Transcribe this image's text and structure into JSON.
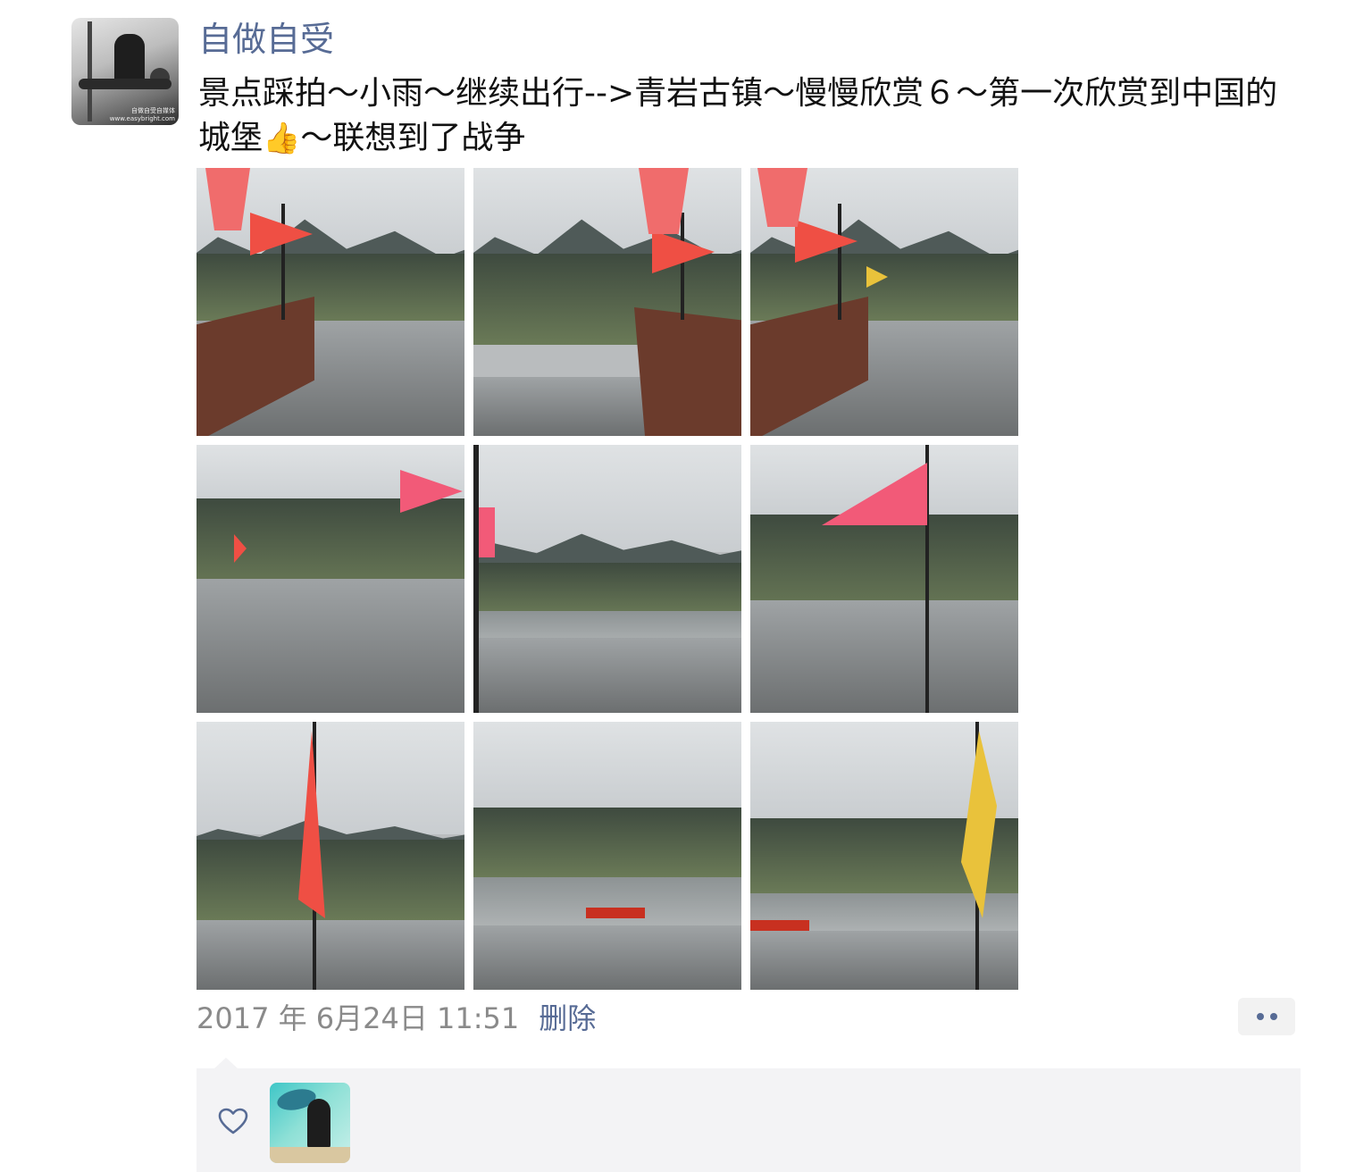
{
  "post": {
    "username": "自做自受",
    "text_main": "景点踩拍～小雨～继续出行-->青岩古镇～慢慢欣赏６～第一次欣赏到中国的城堡",
    "text_emoji": "👍",
    "text_end": "～联想到了战争",
    "avatar_icon": "user-avatar-photo",
    "avatar_watermark": "自做自受自媒体 www.easybright.com",
    "photos": [
      {
        "label": "city-wall-walkway-with-roof-and-flags"
      },
      {
        "label": "town-rooftops-and-mountain-with-flags"
      },
      {
        "label": "wall-walkway-with-tourists-and-flags"
      },
      {
        "label": "wall-corner-with-pink-flag"
      },
      {
        "label": "courtyard-view-from-wall"
      },
      {
        "label": "wall-turret-with-pink-flag"
      },
      {
        "label": "red-flag-over-town"
      },
      {
        "label": "plaza-with-red-banner"
      },
      {
        "label": "yellow-flag-over-plaza"
      }
    ],
    "timestamp": "2017 年 6月24日 11:51",
    "delete_label": "删除",
    "more_icon": "two-dots-more-icon"
  },
  "likes": {
    "heart_icon": "heart-outline-icon",
    "liker_avatar_icon": "liker-avatar-photo"
  },
  "colors": {
    "link": "#576b95",
    "text": "#111111",
    "meta": "#8a8a8a",
    "panel": "#f3f3f5"
  }
}
